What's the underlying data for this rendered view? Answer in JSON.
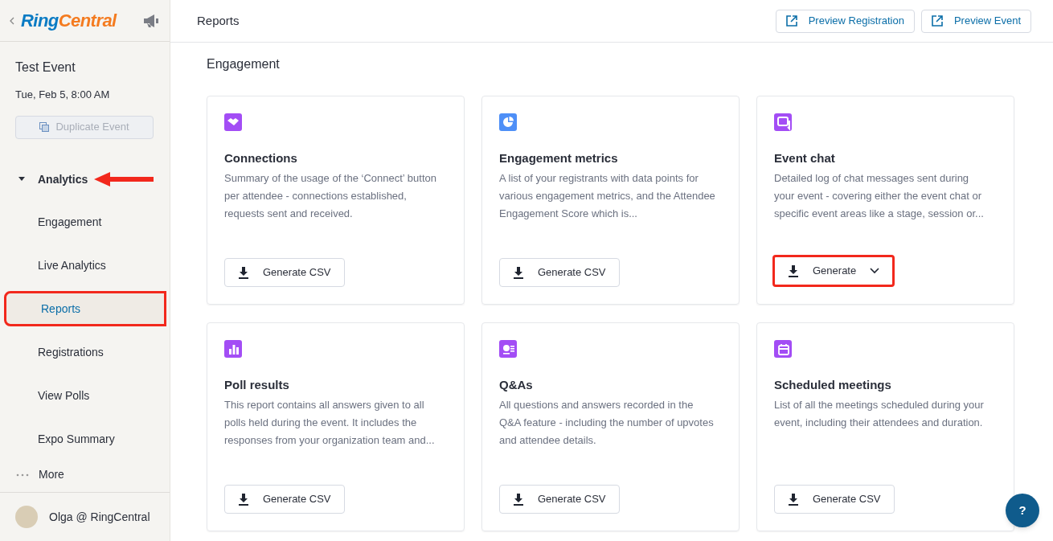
{
  "sidebar": {
    "logo": {
      "first": "Ring",
      "second": "Central"
    },
    "event_title": "Test Event",
    "event_date": "Tue, Feb 5, 8:00 AM",
    "duplicate_button": {
      "label": "Duplicate Event",
      "disabled": true
    },
    "section": {
      "label": "Analytics",
      "expanded": true,
      "annotated": true,
      "items": [
        {
          "label": "Engagement",
          "selected": false,
          "annotated": false
        },
        {
          "label": "Live Analytics",
          "selected": false,
          "annotated": false
        },
        {
          "label": "Reports",
          "selected": true,
          "annotated": true
        },
        {
          "label": "Registrations",
          "selected": false,
          "annotated": false
        },
        {
          "label": "View Polls",
          "selected": false,
          "annotated": false
        },
        {
          "label": "Expo Summary",
          "selected": false,
          "annotated": false
        }
      ]
    },
    "more": "More",
    "user": "Olga @ RingCentral"
  },
  "header": {
    "title": "Reports",
    "buttons": [
      "Preview Registration",
      "Preview Event"
    ]
  },
  "section_title": "Engagement",
  "cards": [
    {
      "kind": "handshake",
      "color": "#a34df5",
      "title": "Connections",
      "description": "Summary of the usage of the ‘Connect’ button per attendee - connections established, requests sent and received.",
      "button": {
        "kind": "csv",
        "label": "Generate CSV",
        "annotated": false
      }
    },
    {
      "kind": "pie",
      "color": "#4e8ff7",
      "title": "Engagement metrics",
      "description": "A list of your registrants with data points for various engagement metrics, and the Attendee Engagement Score which is...",
      "button": {
        "kind": "csv",
        "label": "Generate CSV",
        "annotated": false
      }
    },
    {
      "kind": "chat",
      "color": "#a34df5",
      "title": "Event chat",
      "description": "Detailed log of chat messages sent during your event - covering either the event chat or specific event areas like a stage, session or...",
      "button": {
        "kind": "dropdown",
        "label": "Generate",
        "annotated": true
      }
    },
    {
      "kind": "bars",
      "color": "#a34df5",
      "title": "Poll results",
      "description": "This report contains all answers given to all polls held during the event. It includes the responses from your organization team and...",
      "button": {
        "kind": "csv",
        "label": "Generate CSV",
        "annotated": false
      }
    },
    {
      "kind": "qa",
      "color": "#a34df5",
      "title": "Q&As",
      "description": "All questions and answers recorded in the Q&A feature - including the number of upvotes and attendee details.",
      "button": {
        "kind": "csv",
        "label": "Generate CSV",
        "annotated": false
      }
    },
    {
      "kind": "calendar",
      "color": "#a34df5",
      "title": "Scheduled meetings",
      "description": "List of all the meetings scheduled during your event, including their attendees and duration.",
      "button": {
        "kind": "csv",
        "label": "Generate CSV",
        "annotated": false
      }
    }
  ],
  "help_button": "?"
}
